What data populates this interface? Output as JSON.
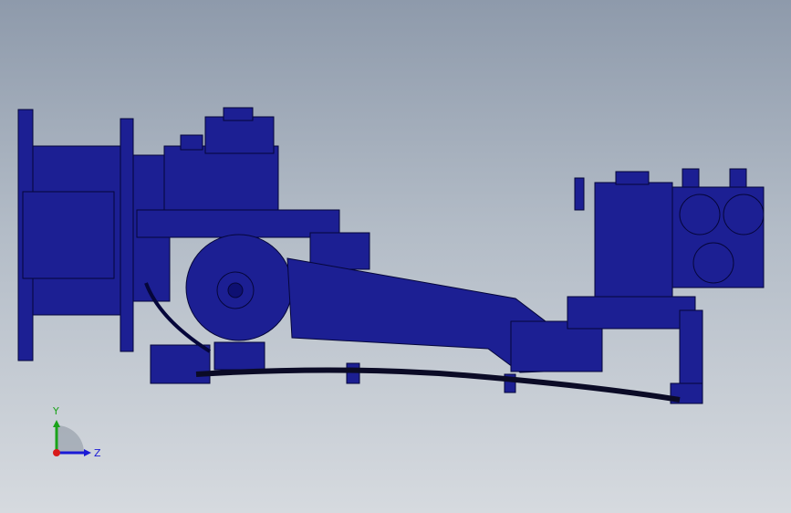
{
  "viewport": {
    "background_top": "#8e9aab",
    "background_bottom": "#d6dadf"
  },
  "model": {
    "body_color": "#1c1f93",
    "edge_color": "#05063a"
  },
  "triad": {
    "y_label": "Y",
    "z_label": "Z",
    "y_color": "#1aa31a",
    "z_color": "#1a1ad6",
    "x_color": "#d81a1a"
  }
}
